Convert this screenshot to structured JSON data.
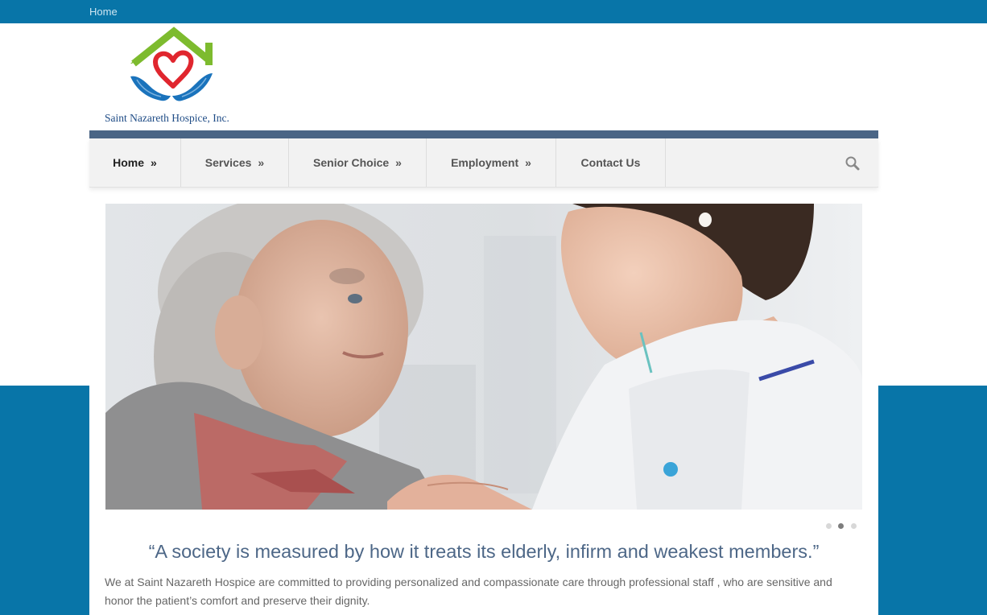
{
  "topbar": {
    "home_link": "Home"
  },
  "logo": {
    "name": "Saint Nazareth Hospice, Inc."
  },
  "nav": {
    "items": [
      {
        "label": "Home",
        "arrow": "»",
        "active": true
      },
      {
        "label": "Services",
        "arrow": "»"
      },
      {
        "label": "Senior Choice",
        "arrow": "»"
      },
      {
        "label": "Employment",
        "arrow": "»"
      },
      {
        "label": "Contact Us"
      }
    ],
    "search_icon": "search-icon"
  },
  "slider": {
    "slide_count": 3,
    "active_slide": 2
  },
  "content": {
    "quote": "“A society is measured by how it treats its elderly, infirm and weakest members.”",
    "intro": "We at Saint Nazareth Hospice are committed to providing personalized and compassionate care through professional staff , who are sensitive and honor the patient’s comfort and preserve their dignity."
  },
  "colors": {
    "brand_blue": "#0875a8",
    "nav_strip": "#4a6585",
    "quote_text": "#4d6787",
    "logo_green": "#7dbb2e",
    "logo_red": "#e0262e",
    "logo_blue": "#1a73bc"
  }
}
